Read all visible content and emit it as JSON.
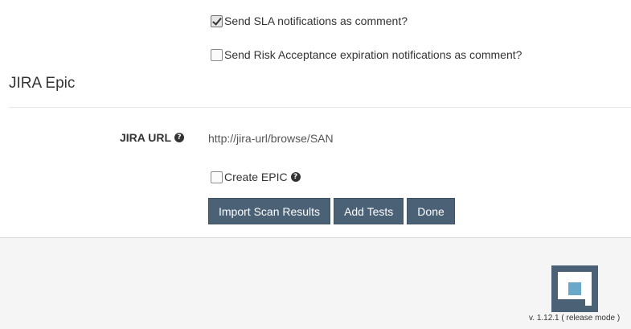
{
  "options": {
    "sla_notifications": {
      "label": "Send SLA notifications as comment?",
      "checked": true
    },
    "risk_acceptance_notifications": {
      "label": "Send Risk Acceptance expiration notifications as comment?",
      "checked": false
    }
  },
  "jira_epic": {
    "title": "JIRA Epic",
    "url_label": "JIRA URL",
    "url_value": "http://jira-url/browse/SAN",
    "create_epic_label": "Create EPIC",
    "create_epic_checked": false,
    "help_icon": "question-circle-icon"
  },
  "actions": {
    "import_label": "Import Scan Results",
    "add_tests_label": "Add Tests",
    "done_label": "Done"
  },
  "footer": {
    "version": "v. 1.12.1 ( release mode )",
    "logo": "app-logo"
  },
  "colors": {
    "button_bg": "#4b6176",
    "logo_accent": "#6aa8c9",
    "footer_bg": "#f5f5f5"
  }
}
